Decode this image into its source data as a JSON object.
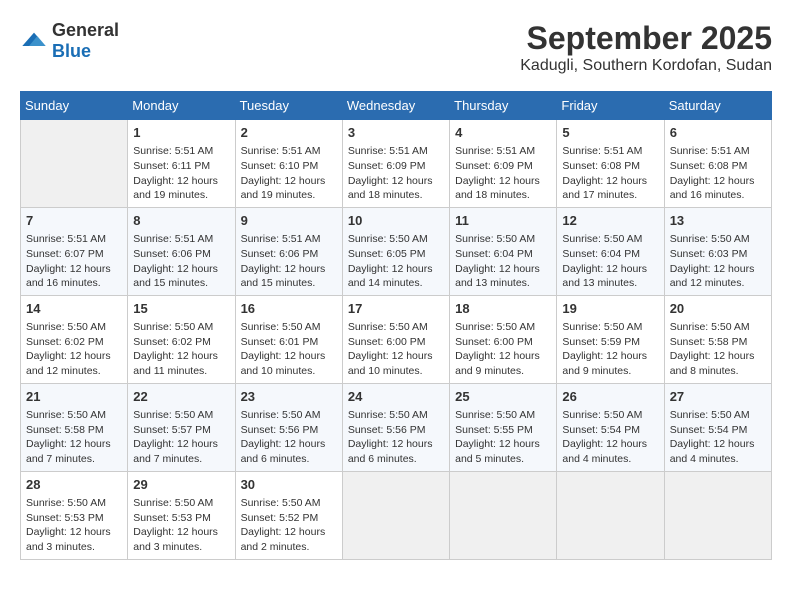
{
  "header": {
    "logo_general": "General",
    "logo_blue": "Blue",
    "month": "September 2025",
    "location": "Kadugli, Southern Kordofan, Sudan"
  },
  "weekdays": [
    "Sunday",
    "Monday",
    "Tuesday",
    "Wednesday",
    "Thursday",
    "Friday",
    "Saturday"
  ],
  "weeks": [
    [
      {
        "day": "",
        "lines": []
      },
      {
        "day": "1",
        "lines": [
          "Sunrise: 5:51 AM",
          "Sunset: 6:11 PM",
          "Daylight: 12 hours",
          "and 19 minutes."
        ]
      },
      {
        "day": "2",
        "lines": [
          "Sunrise: 5:51 AM",
          "Sunset: 6:10 PM",
          "Daylight: 12 hours",
          "and 19 minutes."
        ]
      },
      {
        "day": "3",
        "lines": [
          "Sunrise: 5:51 AM",
          "Sunset: 6:09 PM",
          "Daylight: 12 hours",
          "and 18 minutes."
        ]
      },
      {
        "day": "4",
        "lines": [
          "Sunrise: 5:51 AM",
          "Sunset: 6:09 PM",
          "Daylight: 12 hours",
          "and 18 minutes."
        ]
      },
      {
        "day": "5",
        "lines": [
          "Sunrise: 5:51 AM",
          "Sunset: 6:08 PM",
          "Daylight: 12 hours",
          "and 17 minutes."
        ]
      },
      {
        "day": "6",
        "lines": [
          "Sunrise: 5:51 AM",
          "Sunset: 6:08 PM",
          "Daylight: 12 hours",
          "and 16 minutes."
        ]
      }
    ],
    [
      {
        "day": "7",
        "lines": [
          "Sunrise: 5:51 AM",
          "Sunset: 6:07 PM",
          "Daylight: 12 hours",
          "and 16 minutes."
        ]
      },
      {
        "day": "8",
        "lines": [
          "Sunrise: 5:51 AM",
          "Sunset: 6:06 PM",
          "Daylight: 12 hours",
          "and 15 minutes."
        ]
      },
      {
        "day": "9",
        "lines": [
          "Sunrise: 5:51 AM",
          "Sunset: 6:06 PM",
          "Daylight: 12 hours",
          "and 15 minutes."
        ]
      },
      {
        "day": "10",
        "lines": [
          "Sunrise: 5:50 AM",
          "Sunset: 6:05 PM",
          "Daylight: 12 hours",
          "and 14 minutes."
        ]
      },
      {
        "day": "11",
        "lines": [
          "Sunrise: 5:50 AM",
          "Sunset: 6:04 PM",
          "Daylight: 12 hours",
          "and 13 minutes."
        ]
      },
      {
        "day": "12",
        "lines": [
          "Sunrise: 5:50 AM",
          "Sunset: 6:04 PM",
          "Daylight: 12 hours",
          "and 13 minutes."
        ]
      },
      {
        "day": "13",
        "lines": [
          "Sunrise: 5:50 AM",
          "Sunset: 6:03 PM",
          "Daylight: 12 hours",
          "and 12 minutes."
        ]
      }
    ],
    [
      {
        "day": "14",
        "lines": [
          "Sunrise: 5:50 AM",
          "Sunset: 6:02 PM",
          "Daylight: 12 hours",
          "and 12 minutes."
        ]
      },
      {
        "day": "15",
        "lines": [
          "Sunrise: 5:50 AM",
          "Sunset: 6:02 PM",
          "Daylight: 12 hours",
          "and 11 minutes."
        ]
      },
      {
        "day": "16",
        "lines": [
          "Sunrise: 5:50 AM",
          "Sunset: 6:01 PM",
          "Daylight: 12 hours",
          "and 10 minutes."
        ]
      },
      {
        "day": "17",
        "lines": [
          "Sunrise: 5:50 AM",
          "Sunset: 6:00 PM",
          "Daylight: 12 hours",
          "and 10 minutes."
        ]
      },
      {
        "day": "18",
        "lines": [
          "Sunrise: 5:50 AM",
          "Sunset: 6:00 PM",
          "Daylight: 12 hours",
          "and 9 minutes."
        ]
      },
      {
        "day": "19",
        "lines": [
          "Sunrise: 5:50 AM",
          "Sunset: 5:59 PM",
          "Daylight: 12 hours",
          "and 9 minutes."
        ]
      },
      {
        "day": "20",
        "lines": [
          "Sunrise: 5:50 AM",
          "Sunset: 5:58 PM",
          "Daylight: 12 hours",
          "and 8 minutes."
        ]
      }
    ],
    [
      {
        "day": "21",
        "lines": [
          "Sunrise: 5:50 AM",
          "Sunset: 5:58 PM",
          "Daylight: 12 hours",
          "and 7 minutes."
        ]
      },
      {
        "day": "22",
        "lines": [
          "Sunrise: 5:50 AM",
          "Sunset: 5:57 PM",
          "Daylight: 12 hours",
          "and 7 minutes."
        ]
      },
      {
        "day": "23",
        "lines": [
          "Sunrise: 5:50 AM",
          "Sunset: 5:56 PM",
          "Daylight: 12 hours",
          "and 6 minutes."
        ]
      },
      {
        "day": "24",
        "lines": [
          "Sunrise: 5:50 AM",
          "Sunset: 5:56 PM",
          "Daylight: 12 hours",
          "and 6 minutes."
        ]
      },
      {
        "day": "25",
        "lines": [
          "Sunrise: 5:50 AM",
          "Sunset: 5:55 PM",
          "Daylight: 12 hours",
          "and 5 minutes."
        ]
      },
      {
        "day": "26",
        "lines": [
          "Sunrise: 5:50 AM",
          "Sunset: 5:54 PM",
          "Daylight: 12 hours",
          "and 4 minutes."
        ]
      },
      {
        "day": "27",
        "lines": [
          "Sunrise: 5:50 AM",
          "Sunset: 5:54 PM",
          "Daylight: 12 hours",
          "and 4 minutes."
        ]
      }
    ],
    [
      {
        "day": "28",
        "lines": [
          "Sunrise: 5:50 AM",
          "Sunset: 5:53 PM",
          "Daylight: 12 hours",
          "and 3 minutes."
        ]
      },
      {
        "day": "29",
        "lines": [
          "Sunrise: 5:50 AM",
          "Sunset: 5:53 PM",
          "Daylight: 12 hours",
          "and 3 minutes."
        ]
      },
      {
        "day": "30",
        "lines": [
          "Sunrise: 5:50 AM",
          "Sunset: 5:52 PM",
          "Daylight: 12 hours",
          "and 2 minutes."
        ]
      },
      {
        "day": "",
        "lines": []
      },
      {
        "day": "",
        "lines": []
      },
      {
        "day": "",
        "lines": []
      },
      {
        "day": "",
        "lines": []
      }
    ]
  ]
}
